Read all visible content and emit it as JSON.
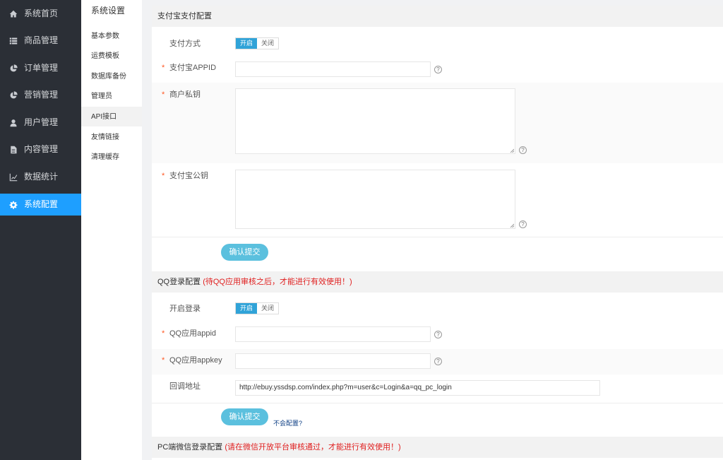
{
  "nav": {
    "items": [
      {
        "label": "系统首页",
        "icon": "home-icon"
      },
      {
        "label": "商品管理",
        "icon": "list-icon"
      },
      {
        "label": "订单管理",
        "icon": "pie-chart-icon"
      },
      {
        "label": "营销管理",
        "icon": "pie-chart-icon"
      },
      {
        "label": "用户管理",
        "icon": "user-icon"
      },
      {
        "label": "内容管理",
        "icon": "document-icon"
      },
      {
        "label": "数据统计",
        "icon": "line-chart-icon"
      },
      {
        "label": "系统配置",
        "icon": "gear-icon"
      }
    ],
    "active_index": 7
  },
  "subnav": {
    "title": "系统设置",
    "items": [
      "基本参数",
      "运费模板",
      "数据库备份",
      "管理员",
      "API接口",
      "友情链接",
      "清理缓存"
    ],
    "active_index": 4
  },
  "alipay": {
    "title": "支付宝支付配置",
    "pay_method_label": "支付方式",
    "switch_on": "开启",
    "switch_off": "关闭",
    "appid_label": "支付宝APPID",
    "appid_value": "",
    "private_key_label": "商户私钥",
    "public_key_label": "支付宝公钥",
    "submit": "确认提交"
  },
  "qq": {
    "title": "QQ登录配置",
    "warning": "(待QQ应用审核之后，才能进行有效使用！)",
    "enable_label": "开启登录",
    "switch_on": "开启",
    "switch_off": "关闭",
    "appid_label": "QQ应用appid",
    "appkey_label": "QQ应用appkey",
    "callback_label": "回调地址",
    "callback_value": "http://ebuy.yssdsp.com/index.php?m=user&c=Login&a=qq_pc_login",
    "submit": "确认提交",
    "help_link": "不会配置?"
  },
  "wechat": {
    "title": "PC端微信登录配置",
    "warning": "(请在微信开放平台审核通过，才能进行有效使用！)"
  },
  "required_mark": "*",
  "help_mark": "?",
  "colors": {
    "accent": "#1e9fff",
    "switch_on": "#30a3d8",
    "button": "#5bc0de",
    "warning": "#e02020",
    "required": "#ff5722"
  }
}
